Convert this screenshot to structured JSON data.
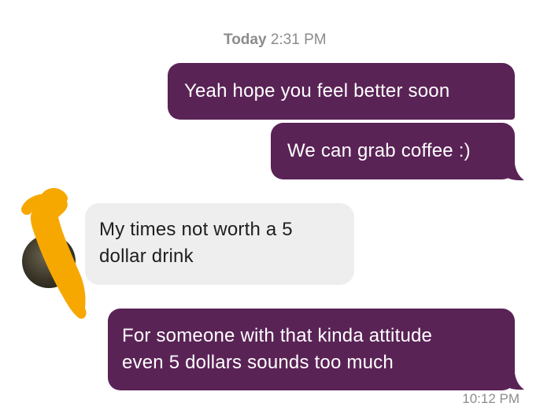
{
  "header": {
    "timestamp_day": "Today",
    "timestamp_time": "2:31 PM"
  },
  "messages": [
    {
      "direction": "outgoing",
      "text": "Yeah hope you feel better soon"
    },
    {
      "direction": "outgoing",
      "text": "We can grab coffee :)"
    },
    {
      "direction": "incoming",
      "lines": [
        "My times not worth a 5",
        "dollar drink"
      ]
    },
    {
      "direction": "outgoing",
      "lines": [
        "For someone with that kinda attitude",
        "even 5 dollars sounds too much"
      ]
    }
  ],
  "footer": {
    "timestamp_time": "10:12 PM"
  },
  "colors": {
    "outgoing_bubble": "#5a2356",
    "incoming_bubble": "#eeeeee",
    "timestamp_text": "#8c8c8c",
    "redaction_marker": "#f7a800"
  }
}
